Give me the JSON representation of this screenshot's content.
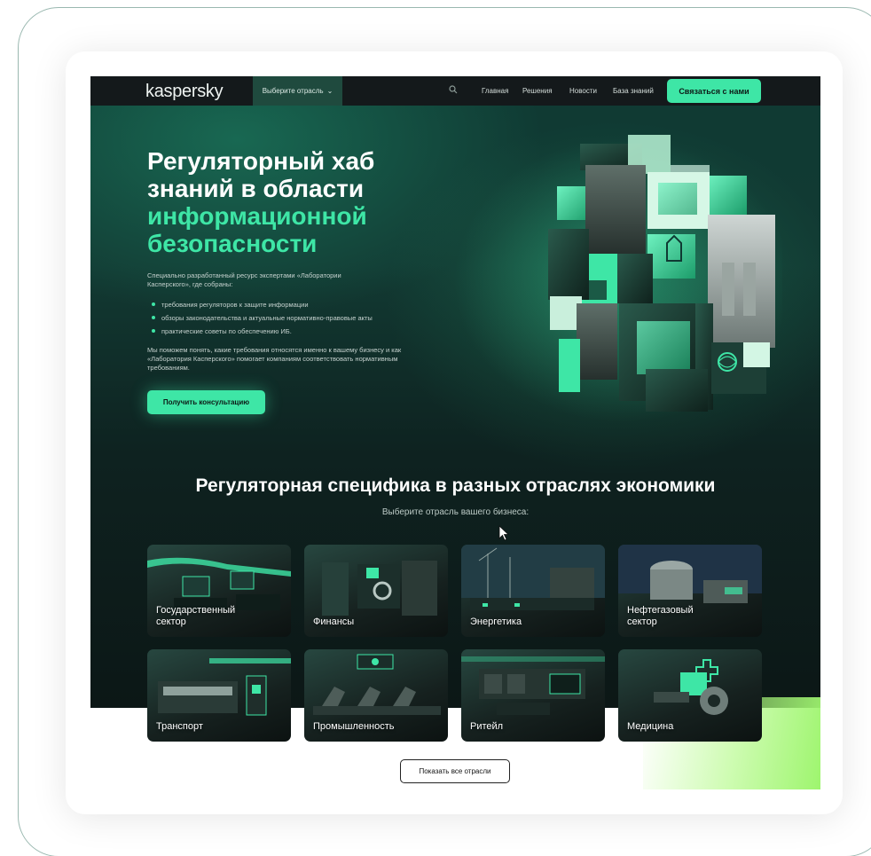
{
  "nav": {
    "logo": "kaspersky",
    "industry_select": "Выберите отрасль",
    "links": [
      "Главная",
      "Решения",
      "Новости",
      "База знаний"
    ],
    "contact_button": "Связаться с нами"
  },
  "hero": {
    "title_line1": "Регуляторный хаб",
    "title_line2": "знаний в области",
    "title_accent1": "информационной",
    "title_accent2": "безопасности",
    "intro": "Специально разработанный ресурс экспертами «Лаборатории Касперского», где собраны:",
    "bullets": [
      "требования регуляторов к защите информации",
      "обзоры законодательства и актуальные нормативно-правовые акты",
      "практические советы по обеспечению ИБ."
    ],
    "note": "Мы поможем понять, какие требования относятся именно к вашему бизнесу и как «Лаборатория Касперского» помогает компаниям соответствовать нормативным требованиям.",
    "consult_button": "Получить консультацию"
  },
  "sectors": {
    "title": "Регуляторная специфика в разных отраслях экономики",
    "subtitle": "Выберите отрасль вашего бизнеса:",
    "tiles": [
      {
        "line1": "Государственный",
        "line2": "сектор"
      },
      {
        "line1": "Финансы",
        "line2": ""
      },
      {
        "line1": "Энергетика",
        "line2": ""
      },
      {
        "line1": "Нефтегазовый",
        "line2": "сектор"
      },
      {
        "line1": "Транспорт",
        "line2": ""
      },
      {
        "line1": "Промышленность",
        "line2": ""
      },
      {
        "line1": "Ритейл",
        "line2": ""
      },
      {
        "line1": "Медицина",
        "line2": ""
      }
    ],
    "show_all_button": "Показать все отрасли"
  },
  "colors": {
    "accent": "#3ee6a6",
    "nav_bg": "#14191b",
    "hero_bg": "#0f3a33"
  }
}
